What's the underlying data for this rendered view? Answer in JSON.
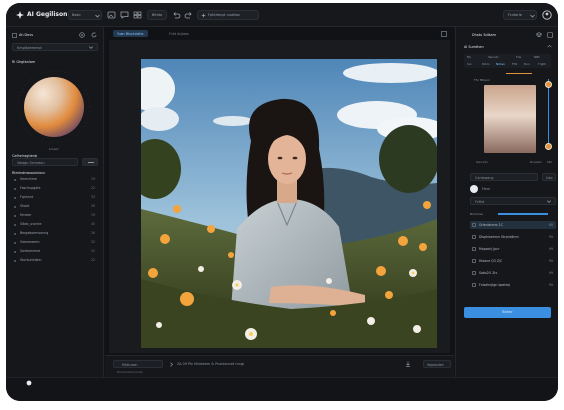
{
  "app": {
    "title": "AI Gegilison"
  },
  "topbar": {
    "mode_select": "Basic",
    "menu_item": "Bfmto",
    "prompt_pill": "Fphtrtecpt nuattav",
    "right_select": "Fcntorle"
  },
  "left_panel": {
    "header": "Ah Devs",
    "project_select": "Kmgitwemmot",
    "section_title": "Rl Ghgtbnlam",
    "orb_caption": "Lmouf",
    "color_label": "Cafhelragtienb",
    "color_select": "Vaiagu Scmreou",
    "list_title": "Rtmlndnwsouinlonc",
    "items": [
      {
        "label": "Smechime",
        "value": "19"
      },
      {
        "label": "Fosrtrupgate",
        "value": "22"
      },
      {
        "label": "Fqnhnnt",
        "value": "33"
      },
      {
        "label": "Shaat",
        "value": "26"
      },
      {
        "label": "Hmeen",
        "value": "19"
      },
      {
        "label": "Slbdc_uvnnte",
        "value": "40"
      },
      {
        "label": "Bmgeboemoonng",
        "value": "26"
      },
      {
        "label": "Geesmaerm",
        "value": "32"
      },
      {
        "label": "Swrbnenmre",
        "value": "32"
      },
      {
        "label": "Sturbunhlahn",
        "value": "22"
      }
    ]
  },
  "center": {
    "tabs": [
      "Yuan Mlscindehe",
      "Fnht Acjtaen"
    ],
    "bottom": {
      "dropdown": "Mstrusen",
      "caption": "2A 09 Pln Mvldwem & Pnoidonnet rnngl",
      "status": "Rooinovbronunta",
      "zoom": "Vopeoden"
    }
  },
  "right_panel": {
    "header": "Dhatu Sdlkam",
    "section_title": "Al Sumthen",
    "slider_labels": [
      "Mn",
      "Slpnetn",
      "Fde",
      "NBS"
    ],
    "slider_sub": [
      "Cai",
      "Dlbm",
      "Ndnsn",
      "Fthl",
      "Bun",
      "Tdgth"
    ],
    "gradient_label": "Fhr Mheon",
    "caption_left": "Soncirtn",
    "caption_mid": "Dvnoam",
    "caption_right": "Slm",
    "search_value": "Caniawauy",
    "search_btn": "Uao",
    "profile_label": "Fiern",
    "select_value": "Fzflnt",
    "layers_header": "Bnhlnow",
    "layers": [
      {
        "label": "Grlenlanmo 1C",
        "value": "88"
      },
      {
        "label": "Dlsphioemnn Strpnidinm",
        "value": "99"
      },
      {
        "label": "Mapochj Jpcr",
        "value": "99"
      },
      {
        "label": "Hlaone Q3 Z/C",
        "value": "99"
      },
      {
        "label": "Sobs2O Zrc",
        "value": "99"
      },
      {
        "label": "Fxlsehnjtgn bpetra)",
        "value": "99"
      }
    ],
    "apply_label": "Bnhnr"
  },
  "colors": {
    "accent": "#3b8fe0",
    "background": "#121417",
    "panel": "#15171b"
  }
}
